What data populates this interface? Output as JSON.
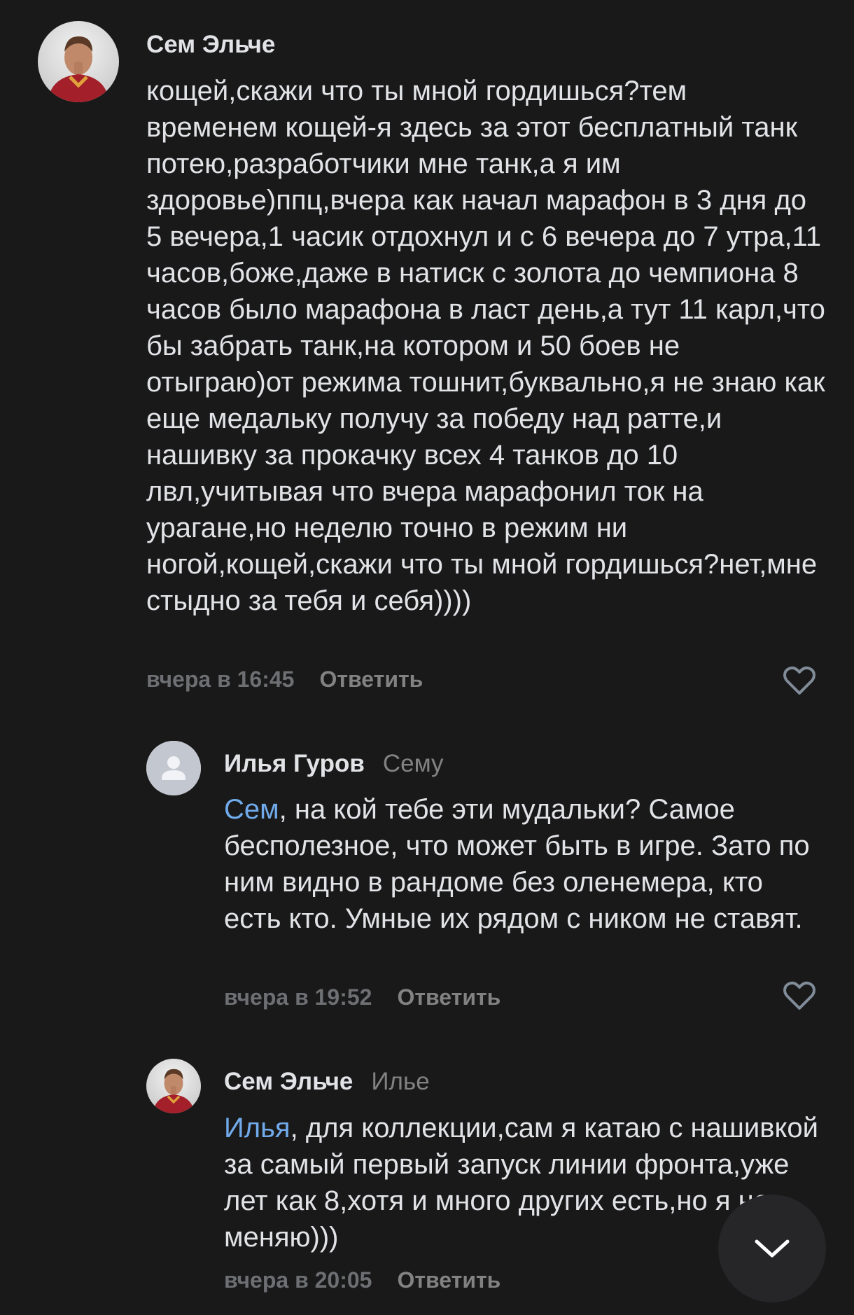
{
  "comments": [
    {
      "author": "Сем Эльче",
      "reply_to": "",
      "mention": "",
      "text": "кощей,скажи что ты мной гордишься?тем временем кощей-я здесь за этот бесплатный танк потею,разработчики мне танк,а я им здоровье)ппц,вчера как начал марафон в 3 дня до 5 вечера,1 часик отдохнул и с 6 вечера до 7 утра,11 часов,боже,даже в натиск с золота до чемпиона 8 часов было марафона в ласт день,а тут 11 карл,что бы забрать танк,на котором и 50 боев не отыграю)от режима тошнит,буквально,я не знаю как еще медальку получу за победу над ратте,и нашивку за прокачку всех 4 танков до 10 лвл,учитывая что вчера марафонил ток на урагане,но неделю точно в режим ни ногой,кощей,скажи что ты мной гордишься?нет,мне стыдно за тебя и себя))))",
      "date": "вчера в 16:45",
      "reply_label": "Ответить",
      "avatar_icon": "user-photo-avatar"
    },
    {
      "author": "Илья Гуров",
      "reply_to": "Сему",
      "mention": "Сем",
      "text": ", на кой тебе эти мудальки? Самое бесполезное, что может быть в игре. Зато по ним видно в рандоме без оленемера, кто есть кто. Умные их рядом с ником не ставят.",
      "date": "вчера в 19:52",
      "reply_label": "Ответить",
      "avatar_icon": "default-user-avatar"
    },
    {
      "author": "Сем Эльче",
      "reply_to": "Илье",
      "mention": "Илья",
      "text": ", для коллекции,сам я катаю с нашивкой за самый первый запуск линии фронта,уже лет как 8,хотя и много других есть,но я не меняю)))",
      "date": "вчера в 20:05",
      "reply_label": "Ответить",
      "avatar_icon": "user-photo-avatar"
    }
  ],
  "icons": {
    "like": "heart-outline-icon",
    "scroll": "chevron-down-icon"
  },
  "colors": {
    "background": "#19191a",
    "text": "#e1e3e6",
    "secondary": "#828282",
    "mention": "#71aaeb"
  }
}
